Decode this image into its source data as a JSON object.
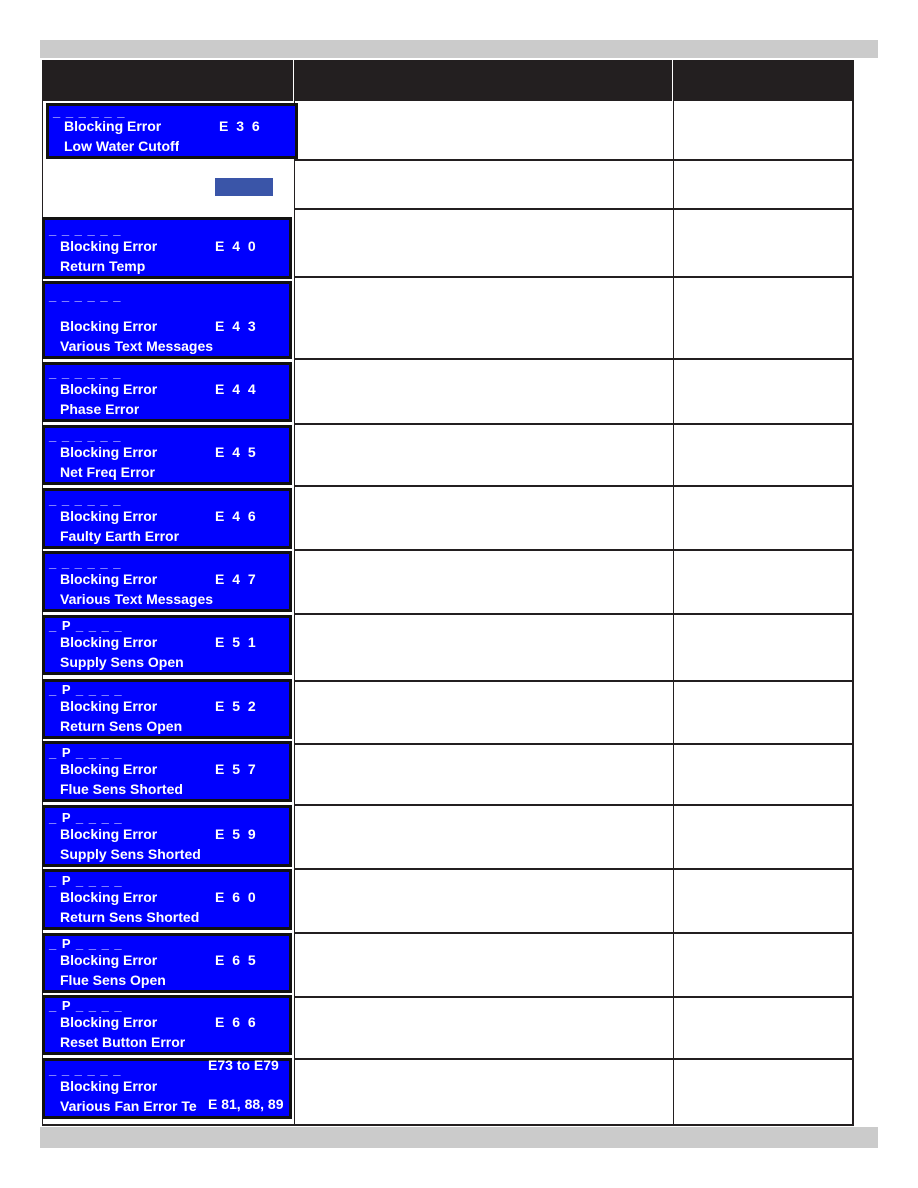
{
  "rows": [
    {
      "mode": "_ _ _ _ _ _",
      "label": "Blocking Error",
      "code": "E 3 6",
      "text": "Low Water Cutoff"
    },
    {
      "mode": "_ _ _ _ _ _",
      "label": "Blocking Error",
      "code": "E 4 0",
      "text": "Return Temp"
    },
    {
      "mode": "_ _ _ _ _ _",
      "label": "Blocking Error",
      "code": "E 4 3",
      "text": "Various Text Messages"
    },
    {
      "mode": "_ _ _ _ _ _",
      "label": "Blocking Error",
      "code": "E 4 4",
      "text": "Phase Error"
    },
    {
      "mode": "_ _ _ _ _ _",
      "label": "Blocking Error",
      "code": "E 4 5",
      "text": "Net Freq Error"
    },
    {
      "mode": "_ _ _ _ _ _",
      "label": "Blocking Error",
      "code": "E 4 6",
      "text": "Faulty Earth Error"
    },
    {
      "mode": "_ _ _ _ _ _",
      "label": "Blocking Error",
      "code": "E 4 7",
      "text": "Various Text Messages"
    },
    {
      "mode": "_ P _ _ _ _",
      "label": "Blocking Error",
      "code": "E 5 1",
      "text": "Supply Sens Open"
    },
    {
      "mode": "_ P _ _ _ _",
      "label": "Blocking Error",
      "code": "E 5 2",
      "text": "Return Sens Open"
    },
    {
      "mode": "_ P _ _ _ _",
      "label": "Blocking Error",
      "code": "E 5 7",
      "text": "Flue Sens Shorted"
    },
    {
      "mode": "_ P _ _ _ _",
      "label": "Blocking Error",
      "code": "E 5 9",
      "text": "Supply Sens Shorted"
    },
    {
      "mode": "_ P _ _ _ _",
      "label": "Blocking Error",
      "code": "E 6 0",
      "text": "Return Sens Shorted"
    },
    {
      "mode": "_ P _ _ _ _",
      "label": "Blocking Error",
      "code": "E 6 5",
      "text": "Flue Sens Open"
    },
    {
      "mode": "_ P _ _ _ _",
      "label": "Blocking Error",
      "code": "E 6 6",
      "text": "Reset Button Error"
    },
    {
      "mode": "_ _ _ _ _ _",
      "label": "Blocking Error",
      "code": "E73 to  E79",
      "text": "Various Fan Error Te",
      "code2": "E 81, 88, 89"
    }
  ],
  "colors": {
    "panel": "#0000fe",
    "header": "#231f20",
    "band": "#cbcbcb"
  }
}
